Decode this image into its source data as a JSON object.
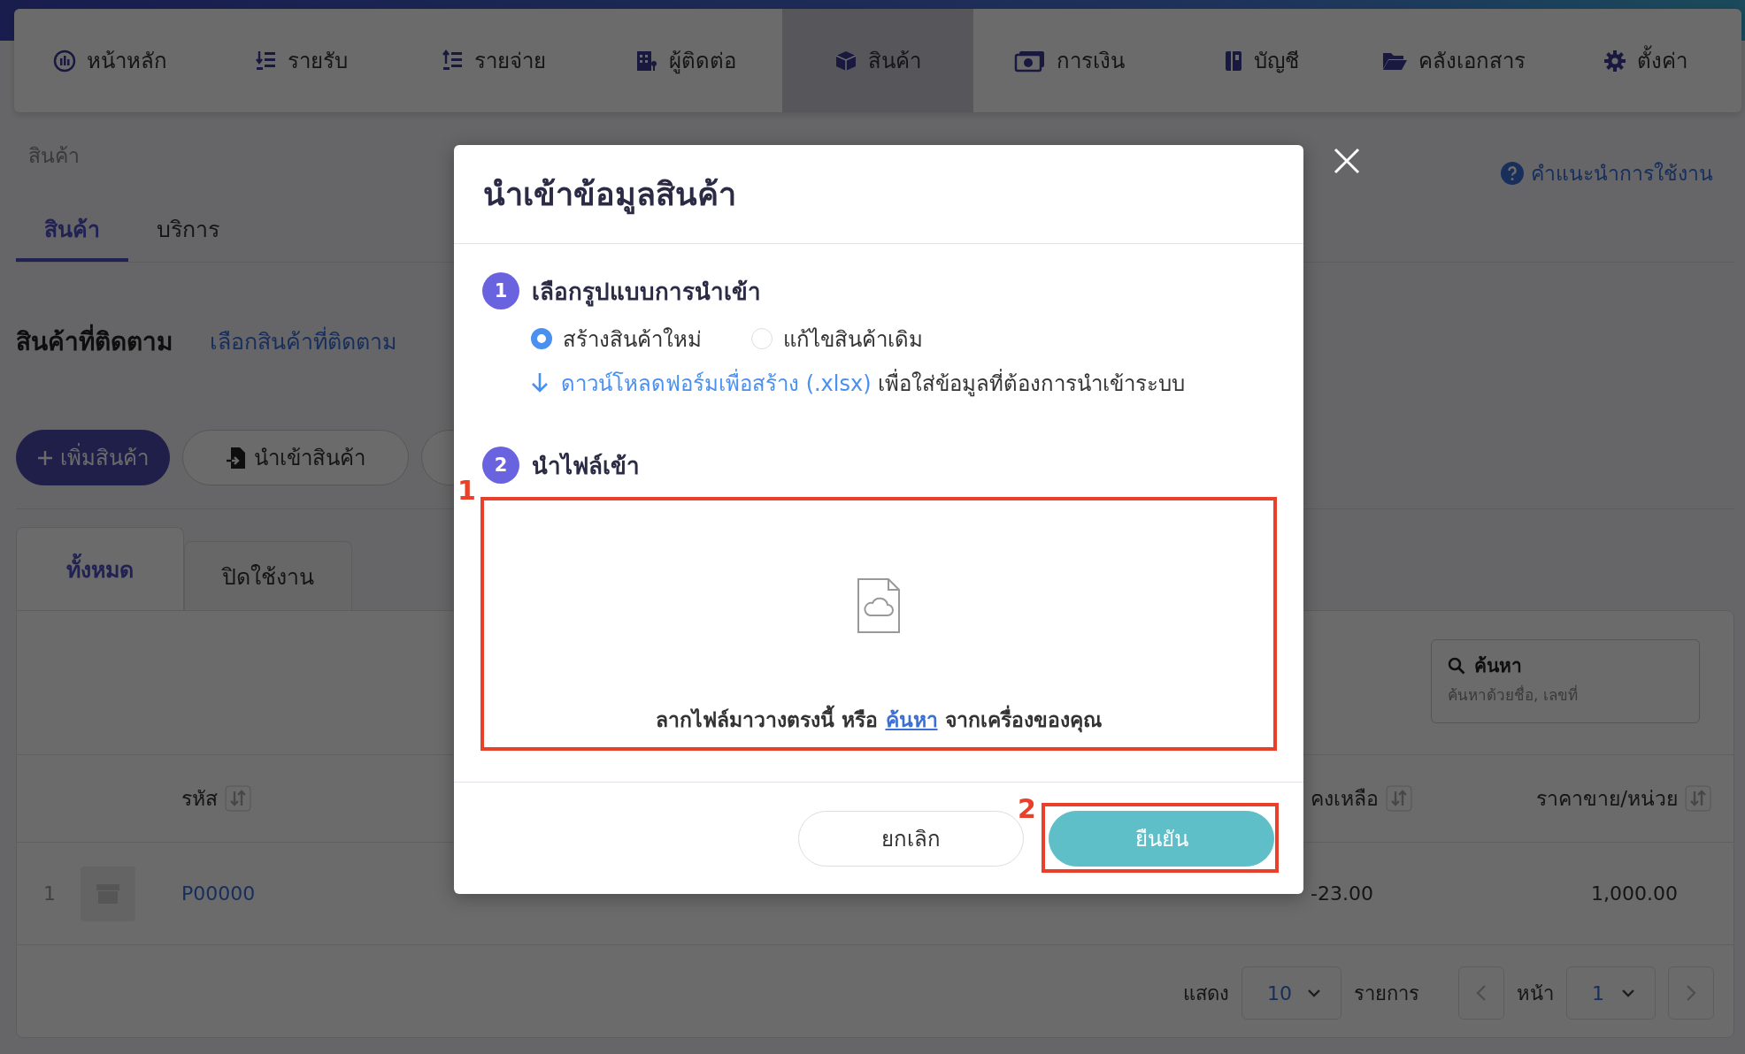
{
  "nav": [
    {
      "label": "หน้าหลัก",
      "selected": false
    },
    {
      "label": "รายรับ",
      "selected": false
    },
    {
      "label": "รายจ่าย",
      "selected": false
    },
    {
      "label": "ผู้ติดต่อ",
      "selected": false
    },
    {
      "label": "สินค้า",
      "selected": true
    },
    {
      "label": "การเงิน",
      "selected": false
    },
    {
      "label": "บัญชี",
      "selected": false
    },
    {
      "label": "คลังเอกสาร",
      "selected": false
    },
    {
      "label": "ตั้งค่า",
      "selected": false
    }
  ],
  "breadcrumb": "สินค้า",
  "help_link": "คำแนะนำการใช้งาน",
  "category_tabs": [
    {
      "label": "สินค้า",
      "selected": true
    },
    {
      "label": "บริการ",
      "selected": false
    }
  ],
  "watchlist": {
    "title": "สินค้าที่ติดตาม",
    "link": "เลือกสินค้าที่ติดตาม"
  },
  "actions": [
    {
      "label": "เพิ่มสินค้า",
      "kind": "primary"
    },
    {
      "label": "นำเข้าสินค้า",
      "kind": "import"
    },
    {
      "kind": "plain"
    }
  ],
  "status_tabs": [
    {
      "label": "ทั้งหมด",
      "selected": true
    },
    {
      "label": "ปิดใช้งาน",
      "selected": false
    }
  ],
  "search": {
    "label": "ค้นหา",
    "placeholder": "ค้นหาด้วยชื่อ, เลขที่"
  },
  "table": {
    "columns": [
      "รหัส",
      "คงเหลือ",
      "ราคาขาย/หน่วย"
    ],
    "rows": [
      {
        "index": "1",
        "code": "P00000",
        "remaining": "-23.00",
        "price": "1,000.00"
      }
    ]
  },
  "pagination": {
    "show_label": "แสดง",
    "page_size": "10",
    "items_label": "รายการ",
    "page_label": "หน้า",
    "page": "1"
  },
  "modal": {
    "title": "นำเข้าข้อมูลสินค้า",
    "steps": [
      {
        "number": "1",
        "title": "เลือกรูปแบบการนำเข้า"
      },
      {
        "number": "2",
        "title": "นำไฟล์เข้า"
      }
    ],
    "options": [
      {
        "label": "สร้างสินค้าใหม่",
        "selected": true
      },
      {
        "label": "แก้ไขสินค้าเดิม",
        "selected": false
      }
    ],
    "download": {
      "link": "ดาวน์โหลดฟอร์มเพื่อสร้าง (.xlsx)",
      "text": "เพื่อใส่ข้อมูลที่ต้องการนำเข้าระบบ"
    },
    "dropzone": {
      "text_before": "ลากไฟล์มาวางตรงนี้ หรือ",
      "link": "ค้นหา",
      "text_after": "จากเครื่องของคุณ"
    },
    "buttons": [
      {
        "label": "ยกเลิก",
        "kind": "secondary"
      },
      {
        "label": "ยืนยัน",
        "kind": "primary"
      }
    ]
  },
  "annotations": [
    {
      "label": "1"
    },
    {
      "label": "2"
    }
  ]
}
